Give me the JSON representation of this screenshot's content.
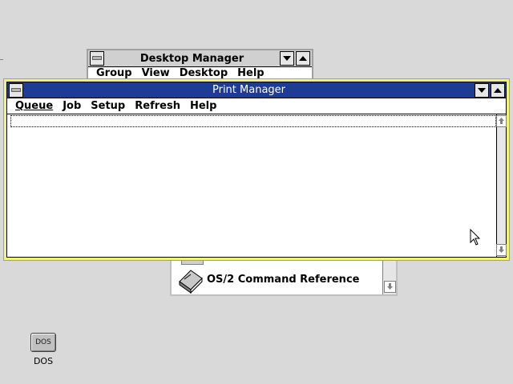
{
  "desktop_manager": {
    "title": "Desktop Manager",
    "menu": [
      "Group",
      "View",
      "Desktop",
      "Help"
    ]
  },
  "help_window": {
    "item_label": "OS/2 Command Reference",
    "item_icon": "book-icon"
  },
  "print_manager": {
    "title": "Print Manager",
    "menu": [
      "Queue",
      "Job",
      "Setup",
      "Refresh",
      "Help"
    ],
    "title_color": "#1e3c96",
    "frame_color": "#f3f373"
  },
  "desktop_icons": [
    {
      "label": "DOS",
      "badge": "DOS",
      "icon": "dos-icon"
    }
  ]
}
